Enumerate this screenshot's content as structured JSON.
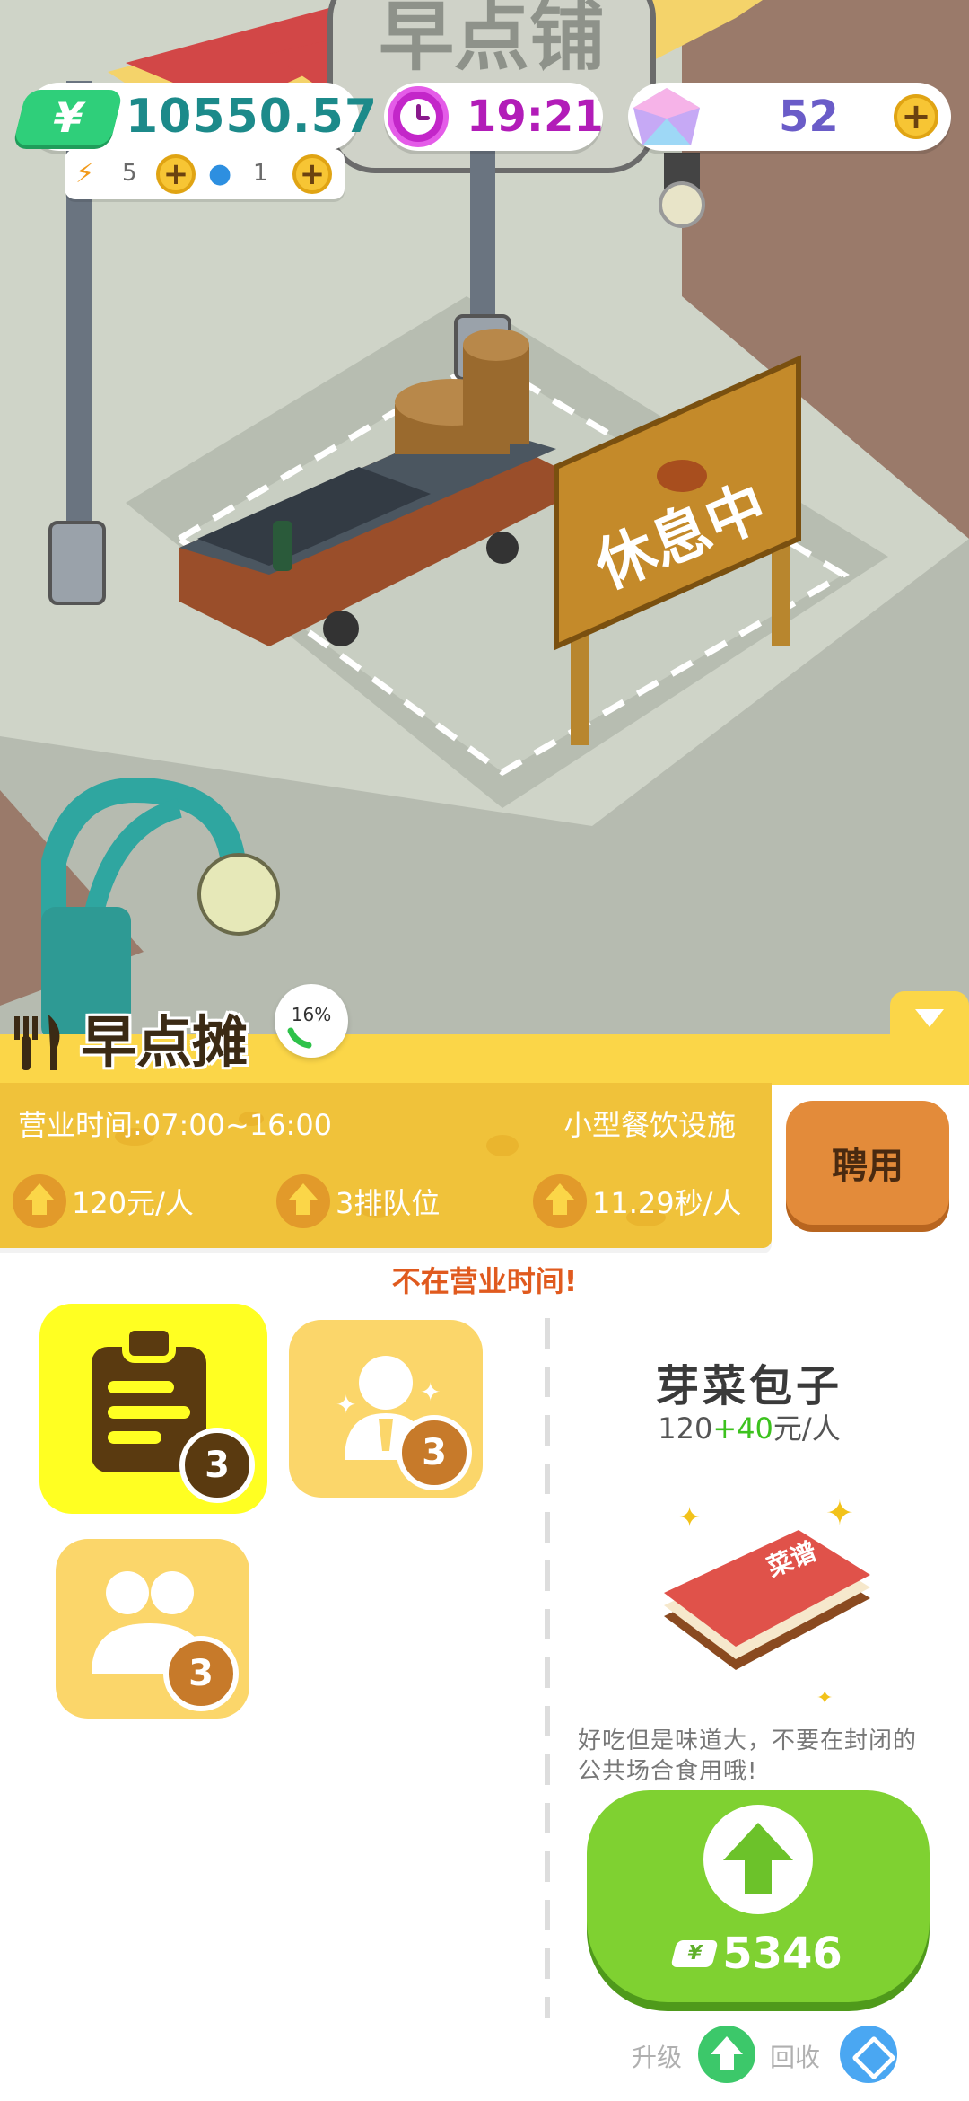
{
  "hud": {
    "money": "10550.57",
    "money_symbol": "¥",
    "clock": "19:21",
    "gems": "52",
    "energy": "5",
    "water": "1"
  },
  "scene": {
    "stall_sign": "早点铺",
    "board_text": "休息中"
  },
  "shop": {
    "title": "早点摊",
    "progress": "16%",
    "hours": "营业时间:07:00~16:00",
    "facility": "小型餐饮设施",
    "stats": [
      "120元/人",
      "3排队位",
      "11.29秒/人"
    ],
    "hire_label": "聘用",
    "warning": "不在营业时间!"
  },
  "tiles": [
    {
      "icon": "clipboard-icon",
      "count": "3"
    },
    {
      "icon": "staff-icon",
      "count": "3"
    },
    {
      "icon": "customers-icon",
      "count": "3"
    }
  ],
  "dish": {
    "name": "芽菜包子",
    "price_base": "120",
    "price_bonus": "+40",
    "price_unit": "元/人",
    "book_label": "菜谱",
    "description": "好吃但是味道大，不要在封闭的公共场合食用哦!",
    "upgrade_cost": "5346",
    "upgrade_label": "升级",
    "recycle_label": "回收"
  },
  "colors": {
    "panel_yellow": "#fbd648",
    "card_yellow": "#f0c23a",
    "hire_orange": "#e38b3a",
    "upgrade_green": "#7fd131",
    "warning_red": "#e05a1e"
  }
}
